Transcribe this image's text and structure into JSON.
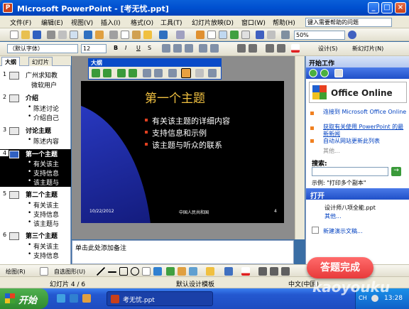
{
  "window": {
    "app_letter": "P",
    "title": "Microsoft PowerPoint - [考无忧.ppt]",
    "min": "_",
    "max": "□",
    "close": "×"
  },
  "menu": {
    "items": [
      "文件(F)",
      "编辑(E)",
      "视图(V)",
      "插入(I)",
      "格式(O)",
      "工具(T)",
      "幻灯片放映(D)",
      "窗口(W)",
      "帮助(H)"
    ],
    "help_placeholder": "键入需要帮助的问题"
  },
  "toolbar": {
    "zoom": "50%"
  },
  "format_toolbar": {
    "font": "（默认字体）",
    "size": "12",
    "bold": "B",
    "italic": "I",
    "underline": "U",
    "shadow": "S",
    "design": "设计(S)",
    "new_slide": "新幻灯片(N)"
  },
  "outline_tabs": {
    "outline": "大纲",
    "slides": "幻灯片"
  },
  "outline": {
    "s1_lines": [
      "广州求知教",
      "微软用户"
    ],
    "s2_title": "介绍",
    "s2_bullets": [
      "陈述讨论",
      "介绍自己"
    ],
    "s3_title": "讨论主题",
    "s3_bullets": [
      "陈述内容"
    ],
    "s4_title": "第一个主题",
    "s4_bullets": [
      "有关该主",
      "支持信息",
      "该主题与"
    ],
    "s5_title": "第二个主题",
    "s5_bullets": [
      "有关该主",
      "支持信息",
      "该主题与"
    ],
    "s6_title": "第三个主题",
    "s6_bullets": [
      "有关该主",
      "支持信息"
    ]
  },
  "outline_toolbar": {
    "title": "大纲"
  },
  "slide": {
    "title": "第一个主题",
    "bullets": [
      "有关该主题的详细内容",
      "支持信息和示例",
      "该主题与听众的联系"
    ],
    "footer_date": "10/22/2012",
    "footer_text": "中国人民共和国",
    "footer_num": "4"
  },
  "notes": {
    "placeholder": "单击此处添加备注"
  },
  "taskpane": {
    "title": "开始工作",
    "office_text": "Office Online",
    "links": [
      "连接到 Microsoft Office Online",
      "获取有关使用 PowerPoint 的最新新闻",
      "自动从网站更新此列表"
    ],
    "more1": "其他...",
    "search_label": "搜索:",
    "example": "示例: \"打印多个副本\"",
    "open_title": "打开",
    "files": [
      "设计师八项全能.ppt"
    ],
    "more2": "其他...",
    "new_pres": "新建演示文稿..."
  },
  "drawbar": {
    "draw": "绘图(R)",
    "autoshapes": "自选图形(U)"
  },
  "status": {
    "slide": "幻灯片 4 / 6",
    "design": "默认设计模板",
    "lang": "中文(中国)"
  },
  "taskbar": {
    "start": "开始",
    "task": "考无忧.ppt",
    "tray_lang": "CH",
    "clock": "13:28"
  },
  "overlay": {
    "badge": "答题完成",
    "watermark": "kaoyouku"
  }
}
